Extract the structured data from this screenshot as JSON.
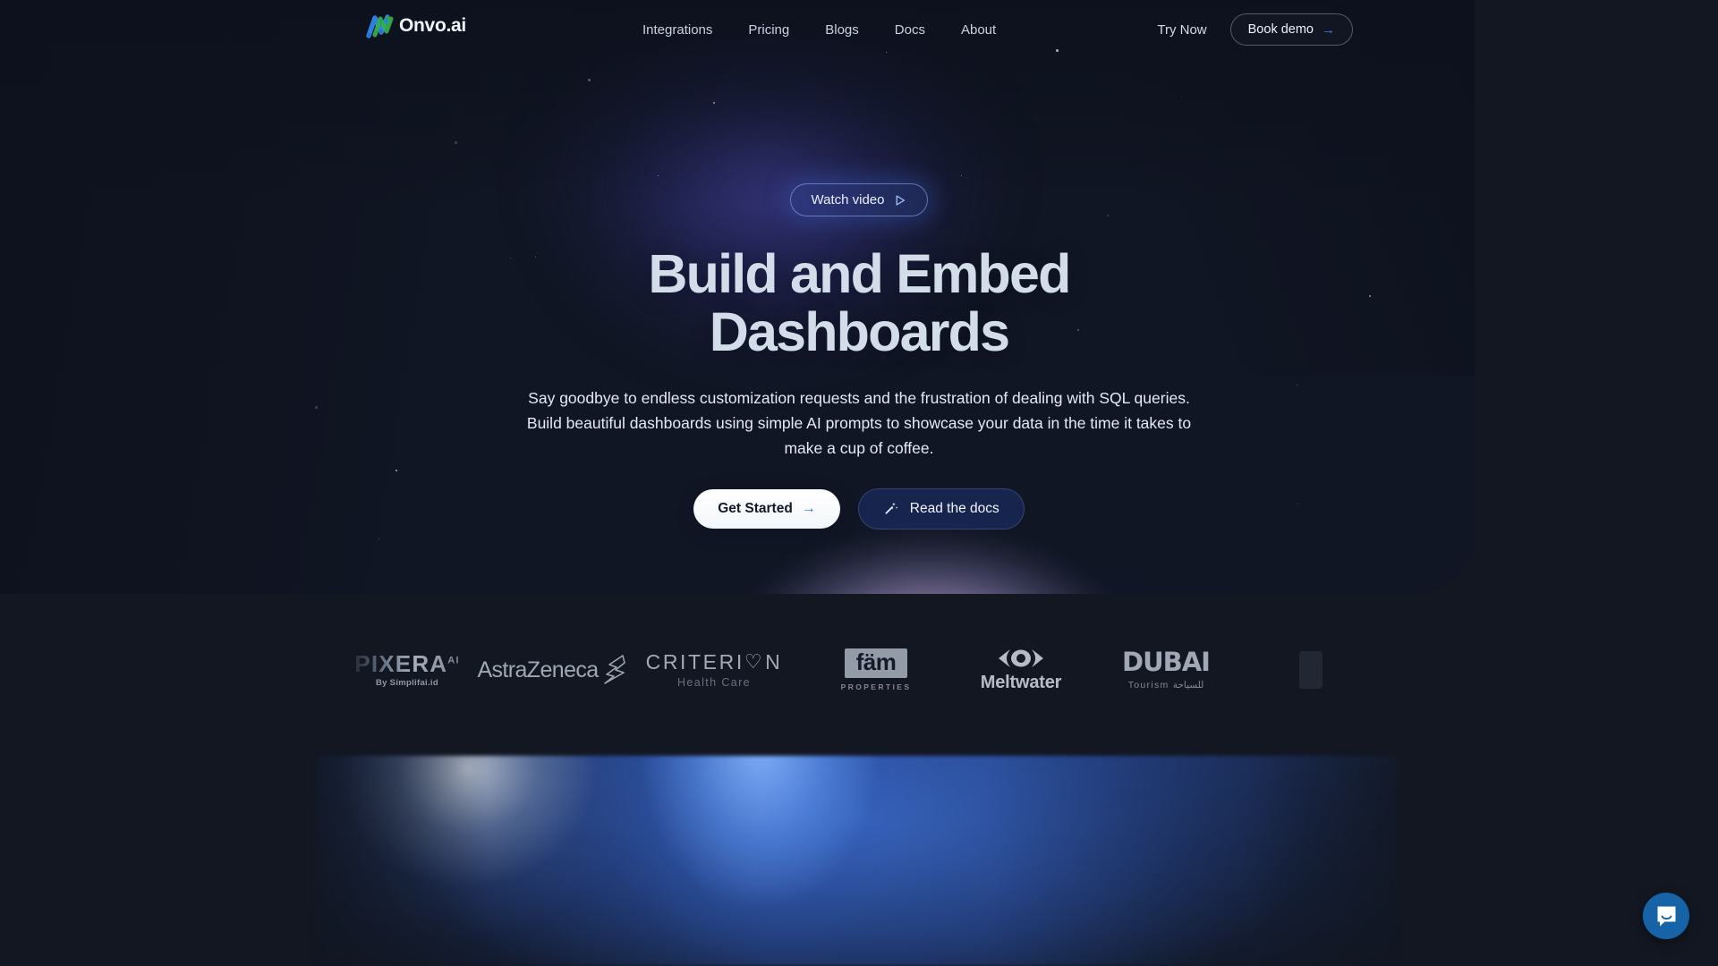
{
  "brand": {
    "name": "Onvo.ai",
    "logo_icon": "onvo-zigzag-logo"
  },
  "nav": {
    "links": [
      {
        "label": "Integrations"
      },
      {
        "label": "Pricing"
      },
      {
        "label": "Blogs"
      },
      {
        "label": "Docs"
      },
      {
        "label": "About"
      }
    ],
    "try_now_label": "Try Now",
    "book_demo_label": "Book demo",
    "book_demo_arrow": "→",
    "accent_color": "#3d7dfc"
  },
  "hero": {
    "watch_badge": {
      "label": "Watch video",
      "icon": "play-triangle-icon"
    },
    "title_line1": "Build and Embed",
    "title_line2": "Dashboards",
    "subtitle": "Say goodbye to endless customization requests and the frustration of dealing with SQL queries. Build beautiful dashboards using simple AI prompts to showcase your data in the time it takes to make a cup of coffee.",
    "primary_cta": {
      "label": "Get Started",
      "arrow": "→"
    },
    "secondary_cta": {
      "label": "Read the docs",
      "icon": "magic-wand-icon"
    }
  },
  "logos": [
    {
      "name": "pixera",
      "primary": "PIXERA",
      "sup": "AI",
      "secondary": "By Simplifai.id"
    },
    {
      "name": "astrazeneca",
      "primary": "AstraZeneca",
      "secondary": ""
    },
    {
      "name": "criterion",
      "primary_a": "CRITERI",
      "primary_b": "N",
      "heart": "♡",
      "secondary": "Health Care"
    },
    {
      "name": "fam",
      "primary": "fäm",
      "secondary": "PROPERTIES"
    },
    {
      "name": "meltwater",
      "primary": "Meltwater",
      "secondary": ""
    },
    {
      "name": "dubai",
      "primary": "DUBAI",
      "secondary": "Tourism للسياحة"
    },
    {
      "name": "next-partner-fading",
      "primary": "",
      "secondary": ""
    }
  ],
  "chat": {
    "icon": "chat-bubble-icon",
    "color": "#1663a8"
  },
  "colors": {
    "page_bg": "#121722",
    "hero_blue": "#5b8ef0",
    "hero_pink": "#e8cdea",
    "hero_purple": "#3b3fa0",
    "text_light": "#e3eaf6"
  }
}
